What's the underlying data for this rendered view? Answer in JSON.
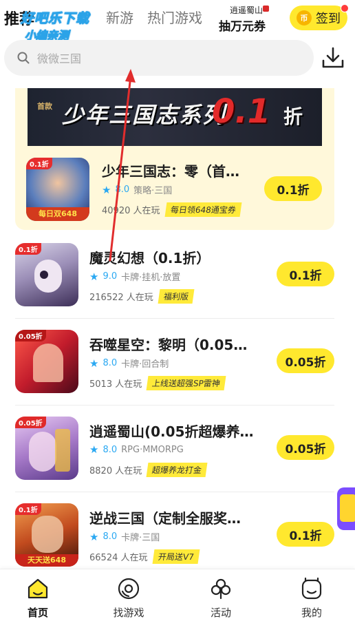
{
  "header": {
    "tabs": [
      {
        "label": "推荐",
        "active": true
      },
      {
        "label": "新游",
        "active": false
      },
      {
        "label": "热门游戏",
        "active": false
      }
    ],
    "watermark": {
      "line1": "好吧乐下载",
      "line2": "小编亲测"
    },
    "promo": {
      "line1": "逍遥蜀山",
      "line2": "抽万元券"
    },
    "signin_label": "签到",
    "coin_glyph": "币"
  },
  "search": {
    "placeholder": "微微三国"
  },
  "featured": {
    "banner": {
      "small": "首款",
      "title": "少年三国志系列",
      "value": "0.1",
      "unit": "折"
    },
    "game": {
      "title": "少年三国志：零（首…",
      "rating": "8.0",
      "genre": "策略·三国",
      "players": "40920 人在玩",
      "tag": "每日领648通宝券",
      "discount": "0.1折",
      "icon_badge": "0.1折",
      "icon_caption": "每日双648"
    }
  },
  "games": [
    {
      "title": "魔灵幻想（0.1折）",
      "rating": "9.0",
      "genre": "卡牌·挂机·放置",
      "players": "216522 人在玩",
      "tag": "福利版",
      "discount": "0.1折",
      "icon_badge": "0.1折",
      "icon_caption": ""
    },
    {
      "title": "吞噬星空：黎明（0.05…",
      "rating": "8.0",
      "genre": "卡牌·回合制",
      "players": "5013 人在玩",
      "tag": "上线送超强SP雷神",
      "discount": "0.05折",
      "icon_badge": "0.05折",
      "icon_caption": ""
    },
    {
      "title": "逍遥蜀山(0.05折超爆养…",
      "rating": "8.0",
      "genre": "RPG·MMORPG",
      "players": "8820 人在玩",
      "tag": "超爆养龙打金",
      "discount": "0.05折",
      "icon_badge": "0.05折",
      "icon_caption": ""
    },
    {
      "title": "逆战三国（定制全服奖…",
      "rating": "8.0",
      "genre": "卡牌·三国",
      "players": "66524 人在玩",
      "tag": "开局送V7",
      "discount": "0.1折",
      "icon_badge": "0.1折",
      "icon_caption": "天天送648"
    }
  ],
  "bottom_nav": [
    {
      "label": "首页",
      "icon": "home-icon",
      "active": true
    },
    {
      "label": "找游戏",
      "icon": "game-disc-icon",
      "active": false
    },
    {
      "label": "活动",
      "icon": "activity-icon",
      "active": false
    },
    {
      "label": "我的",
      "icon": "profile-icon",
      "active": false
    }
  ],
  "colors": {
    "accent": "#ffe82e",
    "rating": "#2aa8f2",
    "arrow": "#e12d2d"
  }
}
